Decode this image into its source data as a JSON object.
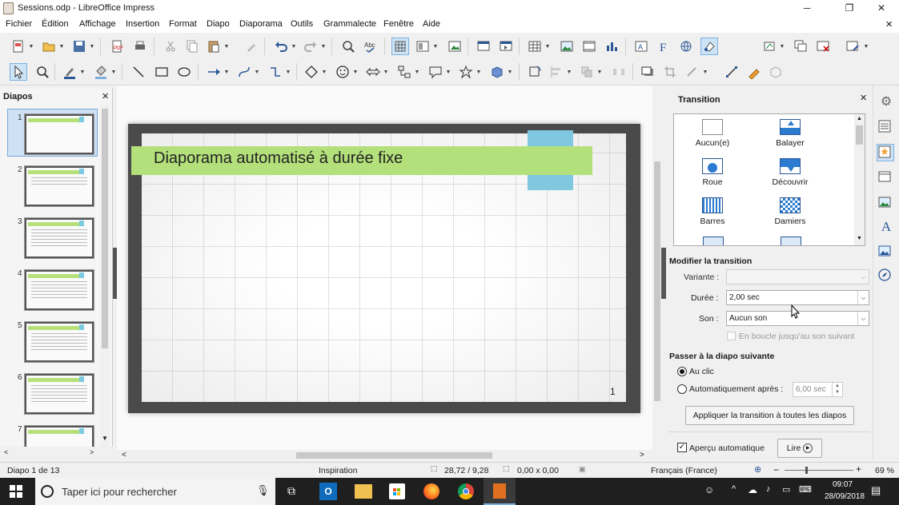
{
  "window": {
    "title": "Sessions.odp - LibreOffice Impress",
    "min": "─",
    "max": "❐",
    "close": "✕"
  },
  "menu": [
    "Fichier",
    "Édition",
    "Affichage",
    "Insertion",
    "Format",
    "Diapo",
    "Diaporama",
    "Outils",
    "Grammalecte",
    "Fenêtre",
    "Aide"
  ],
  "menu_close": "✕",
  "slides_panel": {
    "header": "Diapos",
    "close": "✕",
    "numbers": [
      "1",
      "2",
      "3",
      "4",
      "5",
      "6",
      "7"
    ]
  },
  "slide": {
    "title": "Diaporama automatisé à durée fixe",
    "number": "1"
  },
  "transition_panel": {
    "header": "Transition",
    "close": "✕",
    "effects": [
      "Aucun(e)",
      "Balayer",
      "Roue",
      "Découvrir",
      "Barres",
      "Damiers"
    ],
    "modify_header": "Modifier la transition",
    "variant_label": "Variante :",
    "variant_value": "",
    "duration_label": "Durée :",
    "duration_value": "2,00 sec",
    "sound_label": "Son :",
    "sound_value": "Aucun son",
    "loop_label": "En boucle jusqu'au son suivant",
    "advance_header": "Passer à la diapo suivante",
    "on_click": "Au clic",
    "auto_after": "Automatiquement après :",
    "auto_value": "6,00 sec",
    "apply_all": "Appliquer la transition à toutes les diapos",
    "auto_preview": "Aperçu automatique",
    "play": "Lire"
  },
  "status": {
    "slide": "Diapo 1 de 13",
    "master": "Inspiration",
    "position": "28,72 / 9,28",
    "size": "0,00 x 0,00",
    "language": "Français (France)",
    "zoom_minus": "−",
    "zoom_plus": "+",
    "zoom": "69 %"
  },
  "taskbar": {
    "search_placeholder": "Taper ici pour rechercher",
    "time": "09:07",
    "date": "28/09/2018"
  },
  "colors": {
    "title_bar": "#b3e07a",
    "accent_tab": "#7fc8e0",
    "slide_frame": "#4a4a4a"
  }
}
